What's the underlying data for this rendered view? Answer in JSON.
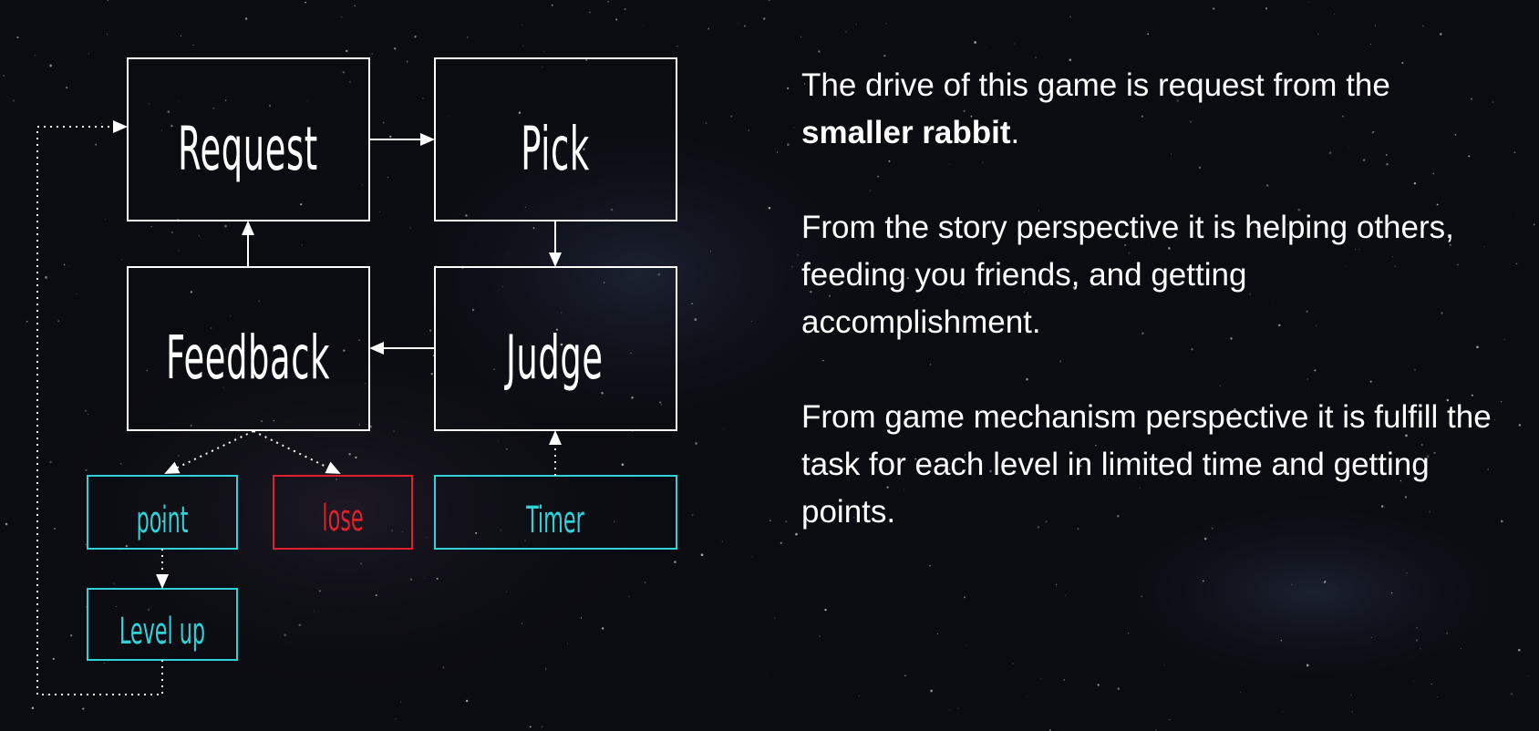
{
  "colors": {
    "background": "#0b0c12",
    "main_box": "#ffffff",
    "cyan": "#2ed3d9",
    "red": "#e0202c"
  },
  "diagram": {
    "nodes": {
      "request": "Request",
      "pick": "Pick",
      "feedback": "Feedback",
      "judge": "Judge",
      "point": "point",
      "lose": "lose",
      "timer": "Timer",
      "level_up": "Level up"
    }
  },
  "text": {
    "p1_prefix": "The drive of this game is request from the ",
    "p1_bold": "smaller rabbit",
    "p1_suffix": ".",
    "p2": "From the story perspective it is helping others, feeding you friends, and getting accomplishment.",
    "p3": "From game mechanism perspective it is fulfill the task for each level in limited time and getting points."
  }
}
